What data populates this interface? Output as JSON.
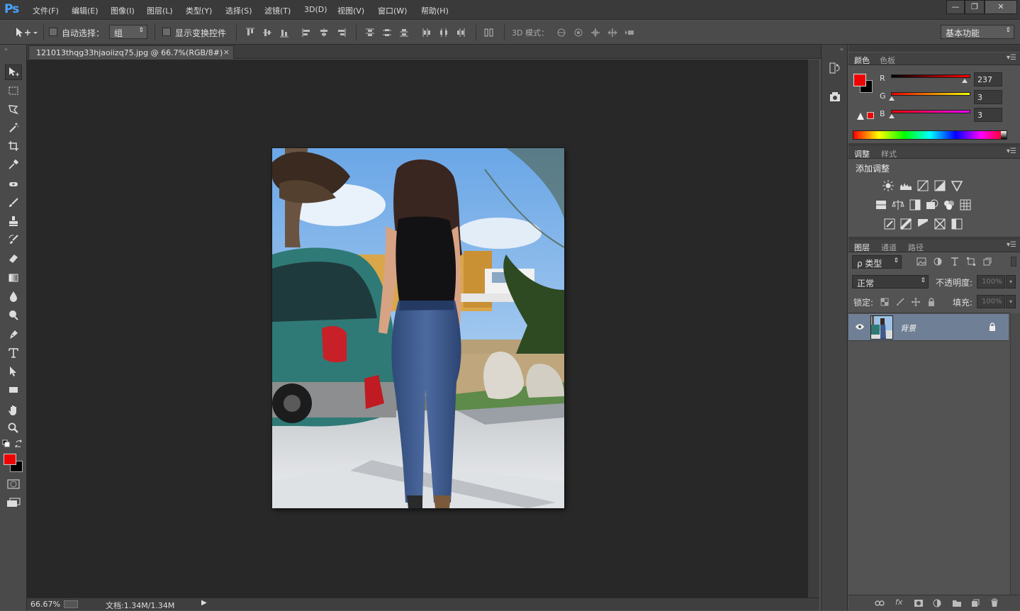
{
  "app": {
    "logo": "Ps"
  },
  "menu": [
    "文件(F)",
    "编辑(E)",
    "图像(I)",
    "图层(L)",
    "类型(Y)",
    "选择(S)",
    "滤镜(T)",
    "3D(D)",
    "视图(V)",
    "窗口(W)",
    "帮助(H)"
  ],
  "window_controls": {
    "minimize": "—",
    "restore": "❐",
    "close": "✕"
  },
  "options": {
    "auto_select_label": "自动选择：",
    "auto_select_value": "组",
    "show_transform_label": "显示变换控件",
    "mode_3d_label": "3D 模式：",
    "workspace": "基本功能"
  },
  "document": {
    "tab_title": "121013thqg33hjaoiizq75.jpg @ 66.7%(RGB/8#)",
    "close": "×"
  },
  "status": {
    "zoom": "66.67%",
    "doc_size": "文档:1.34M/1.34M"
  },
  "color_panel": {
    "tabs": [
      "颜色",
      "色板"
    ],
    "r_label": "R",
    "g_label": "G",
    "b_label": "B",
    "r": "237",
    "g": "3",
    "b": "3",
    "r_frac": 0.93,
    "g_frac": 0.01,
    "b_frac": 0.01,
    "foreground": "#ed0303",
    "background": "#000000"
  },
  "adjust_panel": {
    "tabs": [
      "调整",
      "样式"
    ],
    "title": "添加调整"
  },
  "layers_panel": {
    "tabs": [
      "图层",
      "通道",
      "路径"
    ],
    "filter_label": "ρ 类型",
    "blend_mode": "正常",
    "opacity_label": "不透明度:",
    "opacity_value": "100%",
    "lock_label": "锁定:",
    "fill_label": "填充:",
    "fill_value": "100%",
    "layer_name": "背景"
  },
  "colors": {
    "accent": "#4aa3ff",
    "foreground_swatch": "#ed0303",
    "layer_selected": "#6f7f95"
  }
}
